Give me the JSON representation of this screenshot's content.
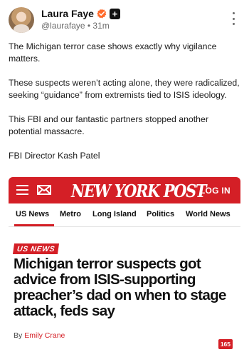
{
  "post": {
    "display_name": "Laura Faye",
    "handle_line": "@laurafaye • 31m",
    "verified_icon": "verified-badge-icon",
    "plus_icon": "plus-badge-icon",
    "plus_label": "+",
    "more_icon": "more-options-icon",
    "paragraphs": [
      "The Michigan terror case shows exactly why vigilance matters.",
      "These suspects weren’t acting alone, they were radicalized, seeking “guidance” from extremists tied to ISIS ideology.",
      "This FBI and our fantastic partners stopped another potential massacre.",
      "FBI Director Kash Patel"
    ]
  },
  "embed": {
    "brand_color": "#d41f26",
    "logo": "NEW YORK POST",
    "login": "LOG IN",
    "menu_icon": "hamburger-menu-icon",
    "mail_icon": "mail-icon",
    "nav": [
      "US News",
      "Metro",
      "Long Island",
      "Politics",
      "World News"
    ],
    "section": "US NEWS",
    "headline": "Michigan terror suspects got advice from ISIS-supporting preacher’s dad on when to stage attack, feds say",
    "byline_prefix": "By",
    "byline_author": "Emily Crane",
    "count": "165"
  }
}
